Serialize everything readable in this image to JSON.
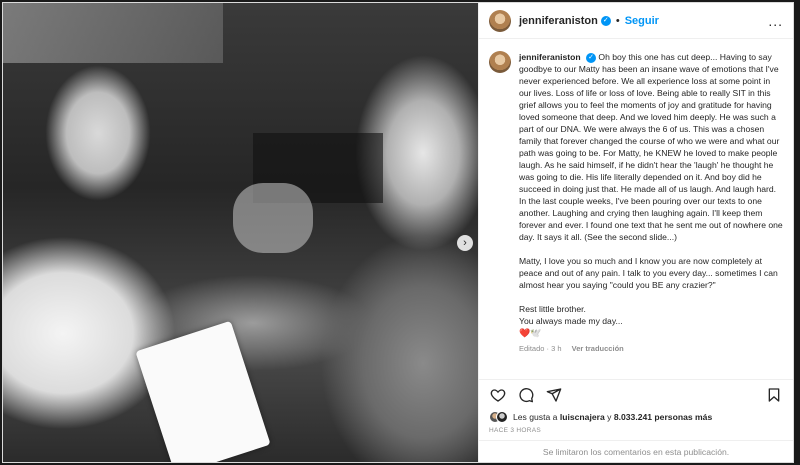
{
  "post": {
    "username": "jenniferaniston",
    "follow_label": "Seguir",
    "dot": "•",
    "more_label": "...",
    "next_label": "›"
  },
  "caption": {
    "p1": "Oh boy this one has cut deep... Having to say goodbye to our Matty has been an insane wave of emotions that I've never experienced before. We all experience loss at some point in our lives. Loss of life or loss of love. Being able to really SIT in this grief allows you to feel the moments of joy and gratitude for having loved someone that deep. And we loved him deeply. He was such a part of our DNA. We were always the 6 of us. This was a chosen family that forever changed the course of who we were and what our path was going to be. For Matty, he KNEW he loved to make people laugh. As he said himself, if he didn't hear the 'laugh' he thought he was going to die. His life literally depended on it. And boy did he succeed in doing just that. He made all of us laugh. And laugh hard. In the last couple weeks, I've been pouring over our texts to one another. Laughing and crying then laughing again. I'll keep them forever and ever. I found one text that he sent me out of nowhere one day. It says it all. (See the second slide...)",
    "p2": "Matty, I love you so much and I know you are now completely at peace and out of any pain. I talk to you every day... sometimes I can almost hear you saying \"could you BE any crazier?\"",
    "p3a": "Rest little brother.",
    "p3b": "You always made my day...",
    "emoji": "❤️🕊️",
    "edited": "Editado · 3 h",
    "translate": "Ver traducción"
  },
  "likes": {
    "prefix": "Les gusta a ",
    "user": "luiscnajera",
    "middle": " y ",
    "count": "8.033.241 personas más"
  },
  "time_label": "HACE 3 HORAS",
  "comments_off": "Se limitaron los comentarios en esta publicación."
}
